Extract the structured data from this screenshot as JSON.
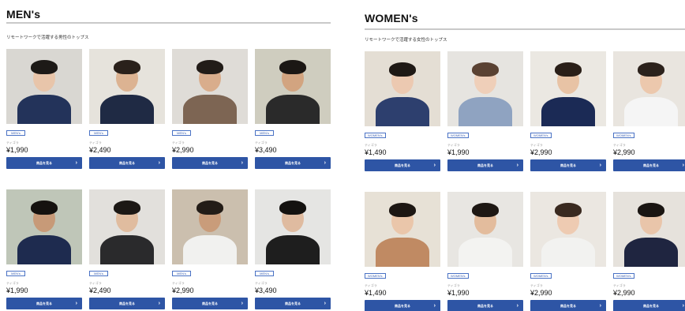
{
  "men": {
    "title": "MEN's",
    "subtitle": "リモートワークで活躍する男性のトップス",
    "products": [
      {
        "badge": "MEN's",
        "brand": "ティゴラ",
        "price": "¥1,990",
        "button": "商品を見る",
        "bg": "#d9d7d2",
        "shirt": "#23335a",
        "hair": "#1d1a17",
        "skin": "#e8c5aa"
      },
      {
        "badge": "MEN's",
        "brand": "ティゴラ",
        "price": "¥2,490",
        "button": "商品を見る",
        "bg": "#e6e3dc",
        "shirt": "#1f2a44",
        "hair": "#2a211b",
        "skin": "#dcb392"
      },
      {
        "badge": "MEN's",
        "brand": "ティゴラ",
        "price": "¥2,990",
        "button": "商品を見る",
        "bg": "#dfdcd7",
        "shirt": "#7d6553",
        "hair": "#221c18",
        "skin": "#d9ad8c"
      },
      {
        "badge": "MEN's",
        "brand": "ティゴラ",
        "price": "¥3,490",
        "button": "商品を見る",
        "bg": "#cfcdbf",
        "shirt": "#2a2a2a",
        "hair": "#1b1714",
        "skin": "#d2a480"
      },
      {
        "badge": "MEN's",
        "brand": "ティゴラ",
        "price": "¥1,990",
        "button": "商品を見る",
        "bg": "#bfc6b8",
        "shirt": "#1e2b4f",
        "hair": "#15120f",
        "skin": "#c79a78"
      },
      {
        "badge": "MEN's",
        "brand": "ティゴラ",
        "price": "¥2,490",
        "button": "商品を見る",
        "bg": "#e2e0dc",
        "shirt": "#2a2a2c",
        "hair": "#1c1815",
        "skin": "#e0bc9f"
      },
      {
        "badge": "MEN's",
        "brand": "ティゴラ",
        "price": "¥2,990",
        "button": "商品を見る",
        "bg": "#cbbfae",
        "shirt": "#f1f1ef",
        "hair": "#231c17",
        "skin": "#c99c7a"
      },
      {
        "badge": "MEN's",
        "brand": "ティゴラ",
        "price": "¥3,490",
        "button": "商品を見る",
        "bg": "#e5e5e3",
        "shirt": "#1e1e1e",
        "hair": "#141210",
        "skin": "#dfbba0"
      }
    ]
  },
  "women": {
    "title": "WOMEN's",
    "subtitle": "リモートワークで活躍する女性のトップス",
    "products": [
      {
        "badge": "WOMEN's",
        "brand": "ティゴラ",
        "price": "¥1,490",
        "button": "商品を見る",
        "bg": "#e4ded4",
        "shirt": "#2d3f6e",
        "hair": "#1f1915",
        "skin": "#ecc9b1"
      },
      {
        "badge": "WOMEN's",
        "brand": "ティゴラ",
        "price": "¥1,990",
        "button": "商品を見る",
        "bg": "#e6e4e0",
        "shirt": "#8fa3c1",
        "hair": "#5a4233",
        "skin": "#efcfb9"
      },
      {
        "badge": "WOMEN's",
        "brand": "ティゴラ",
        "price": "¥2,990",
        "button": "商品を見る",
        "bg": "#ebe8e2",
        "shirt": "#1b2a55",
        "hair": "#2a1f18",
        "skin": "#e8c3a5"
      },
      {
        "badge": "WOMEN's",
        "brand": "ティゴラ",
        "price": "¥2,990",
        "button": "商品を見る",
        "bg": "#e9e5df",
        "shirt": "#f5f5f5",
        "hair": "#2c221c",
        "skin": "#ecc8ad"
      },
      {
        "badge": "WOMEN's",
        "brand": "ティゴラ",
        "price": "¥1,490",
        "button": "商品を見る",
        "bg": "#e7e1d6",
        "shirt": "#c08a63",
        "hair": "#1d1713",
        "skin": "#eac6aa"
      },
      {
        "badge": "WOMEN's",
        "brand": "ティゴラ",
        "price": "¥1,990",
        "button": "商品を見る",
        "bg": "#e8e6e2",
        "shirt": "#f3f3f1",
        "hair": "#1e1814",
        "skin": "#e3bc9d"
      },
      {
        "badge": "WOMEN's",
        "brand": "ティゴラ",
        "price": "¥2,990",
        "button": "商品を見る",
        "bg": "#ebe7e1",
        "shirt": "#f2f2f0",
        "hair": "#3a2a20",
        "skin": "#eecbb2"
      },
      {
        "badge": "WOMEN's",
        "brand": "ティゴラ",
        "price": "¥2,990",
        "button": "商品を見る",
        "bg": "#e6e2dc",
        "shirt": "#1f2540",
        "hair": "#1a1512",
        "skin": "#e9c5aa"
      }
    ]
  }
}
